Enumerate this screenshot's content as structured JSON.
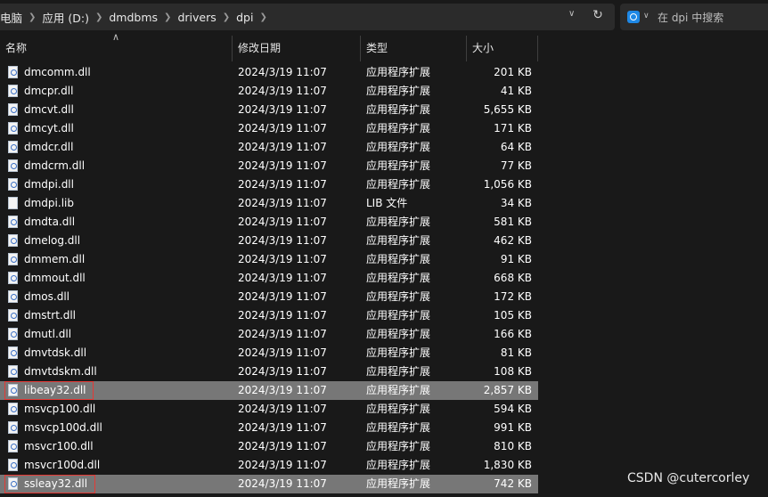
{
  "breadcrumb": [
    "电脑",
    "应用 (D:)",
    "dmdbms",
    "drivers",
    "dpi"
  ],
  "search_placeholder": "在 dpi 中搜索",
  "columns": {
    "name": "名称",
    "date": "修改日期",
    "type": "类型",
    "size": "大小"
  },
  "files": [
    {
      "name": "dmcomm.dll",
      "date": "2024/3/19 11:07",
      "type": "应用程序扩展",
      "size": "201 KB",
      "icon": "dll-icon",
      "selected": false,
      "highlighted": false
    },
    {
      "name": "dmcpr.dll",
      "date": "2024/3/19 11:07",
      "type": "应用程序扩展",
      "size": "41 KB",
      "icon": "dll-icon",
      "selected": false,
      "highlighted": false
    },
    {
      "name": "dmcvt.dll",
      "date": "2024/3/19 11:07",
      "type": "应用程序扩展",
      "size": "5,655 KB",
      "icon": "dll-icon",
      "selected": false,
      "highlighted": false
    },
    {
      "name": "dmcyt.dll",
      "date": "2024/3/19 11:07",
      "type": "应用程序扩展",
      "size": "171 KB",
      "icon": "dll-icon",
      "selected": false,
      "highlighted": false
    },
    {
      "name": "dmdcr.dll",
      "date": "2024/3/19 11:07",
      "type": "应用程序扩展",
      "size": "64 KB",
      "icon": "dll-icon",
      "selected": false,
      "highlighted": false
    },
    {
      "name": "dmdcrm.dll",
      "date": "2024/3/19 11:07",
      "type": "应用程序扩展",
      "size": "77 KB",
      "icon": "dll-icon",
      "selected": false,
      "highlighted": false
    },
    {
      "name": "dmdpi.dll",
      "date": "2024/3/19 11:07",
      "type": "应用程序扩展",
      "size": "1,056 KB",
      "icon": "dll-icon",
      "selected": false,
      "highlighted": false
    },
    {
      "name": "dmdpi.lib",
      "date": "2024/3/19 11:07",
      "type": "LIB 文件",
      "size": "34 KB",
      "icon": "file-icon",
      "selected": false,
      "highlighted": false
    },
    {
      "name": "dmdta.dll",
      "date": "2024/3/19 11:07",
      "type": "应用程序扩展",
      "size": "581 KB",
      "icon": "dll-icon",
      "selected": false,
      "highlighted": false
    },
    {
      "name": "dmelog.dll",
      "date": "2024/3/19 11:07",
      "type": "应用程序扩展",
      "size": "462 KB",
      "icon": "dll-icon",
      "selected": false,
      "highlighted": false
    },
    {
      "name": "dmmem.dll",
      "date": "2024/3/19 11:07",
      "type": "应用程序扩展",
      "size": "91 KB",
      "icon": "dll-icon",
      "selected": false,
      "highlighted": false
    },
    {
      "name": "dmmout.dll",
      "date": "2024/3/19 11:07",
      "type": "应用程序扩展",
      "size": "668 KB",
      "icon": "dll-icon",
      "selected": false,
      "highlighted": false
    },
    {
      "name": "dmos.dll",
      "date": "2024/3/19 11:07",
      "type": "应用程序扩展",
      "size": "172 KB",
      "icon": "dll-icon",
      "selected": false,
      "highlighted": false
    },
    {
      "name": "dmstrt.dll",
      "date": "2024/3/19 11:07",
      "type": "应用程序扩展",
      "size": "105 KB",
      "icon": "dll-icon",
      "selected": false,
      "highlighted": false
    },
    {
      "name": "dmutl.dll",
      "date": "2024/3/19 11:07",
      "type": "应用程序扩展",
      "size": "166 KB",
      "icon": "dll-icon",
      "selected": false,
      "highlighted": false
    },
    {
      "name": "dmvtdsk.dll",
      "date": "2024/3/19 11:07",
      "type": "应用程序扩展",
      "size": "81 KB",
      "icon": "dll-icon",
      "selected": false,
      "highlighted": false
    },
    {
      "name": "dmvtdskm.dll",
      "date": "2024/3/19 11:07",
      "type": "应用程序扩展",
      "size": "108 KB",
      "icon": "dll-icon",
      "selected": false,
      "highlighted": false
    },
    {
      "name": "libeay32.dll",
      "date": "2024/3/19 11:07",
      "type": "应用程序扩展",
      "size": "2,857 KB",
      "icon": "dll-icon",
      "selected": true,
      "highlighted": true
    },
    {
      "name": "msvcp100.dll",
      "date": "2024/3/19 11:07",
      "type": "应用程序扩展",
      "size": "594 KB",
      "icon": "dll-icon",
      "selected": false,
      "highlighted": false
    },
    {
      "name": "msvcp100d.dll",
      "date": "2024/3/19 11:07",
      "type": "应用程序扩展",
      "size": "991 KB",
      "icon": "dll-icon",
      "selected": false,
      "highlighted": false
    },
    {
      "name": "msvcr100.dll",
      "date": "2024/3/19 11:07",
      "type": "应用程序扩展",
      "size": "810 KB",
      "icon": "dll-icon",
      "selected": false,
      "highlighted": false
    },
    {
      "name": "msvcr100d.dll",
      "date": "2024/3/19 11:07",
      "type": "应用程序扩展",
      "size": "1,830 KB",
      "icon": "dll-icon",
      "selected": false,
      "highlighted": false
    },
    {
      "name": "ssleay32.dll",
      "date": "2024/3/19 11:07",
      "type": "应用程序扩展",
      "size": "742 KB",
      "icon": "dll-icon",
      "selected": true,
      "highlighted": true
    }
  ],
  "watermark": "CSDN @cutercorley",
  "colors": {
    "background": "#191919",
    "selected_row": "#777777",
    "highlight_border": "#e53935",
    "search_icon": "#1e88e5"
  }
}
